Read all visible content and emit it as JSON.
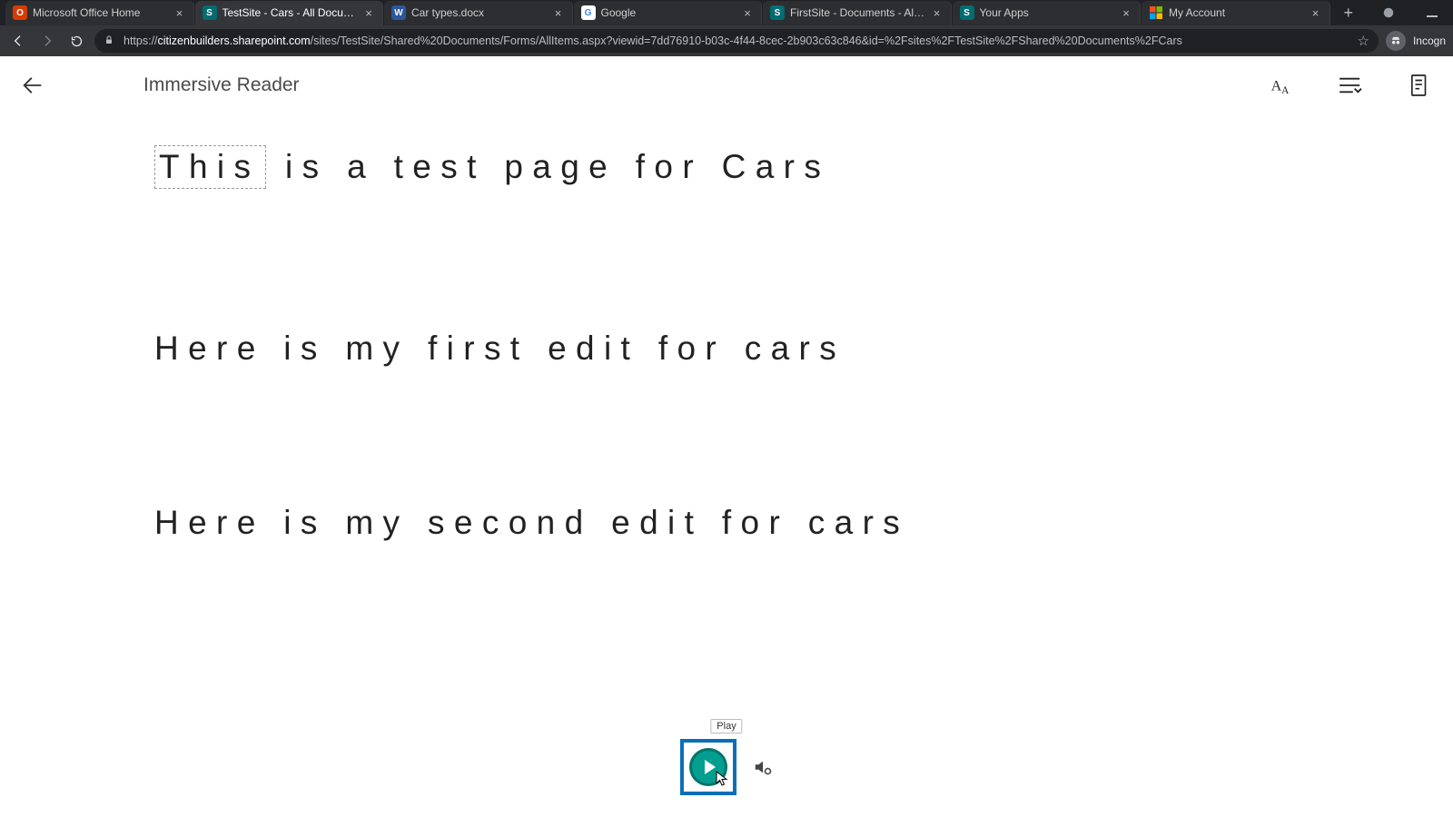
{
  "browser": {
    "tabs": [
      {
        "title": "Microsoft Office Home",
        "favicon_bg": "#d83b01",
        "favicon_fg": "#ffffff",
        "favicon_letter": "O",
        "name": "tab-office-home"
      },
      {
        "title": "TestSite - Cars - All Documents",
        "favicon_bg": "#036c70",
        "favicon_fg": "#ffffff",
        "favicon_letter": "S",
        "name": "tab-testsite-cars",
        "active": true
      },
      {
        "title": "Car types.docx",
        "favicon_bg": "#2b579a",
        "favicon_fg": "#ffffff",
        "favicon_letter": "W",
        "name": "tab-car-types"
      },
      {
        "title": "Google",
        "favicon_bg": "#ffffff",
        "favicon_fg": "#4285f4",
        "favicon_letter": "G",
        "name": "tab-google"
      },
      {
        "title": "FirstSite - Documents - All Docu…",
        "favicon_bg": "#036c70",
        "favicon_fg": "#ffffff",
        "favicon_letter": "S",
        "name": "tab-firstsite-docs"
      },
      {
        "title": "Your Apps",
        "favicon_bg": "#036c70",
        "favicon_fg": "#ffffff",
        "favicon_letter": "S",
        "name": "tab-your-apps"
      },
      {
        "title": "My Account",
        "favicon_bg": "#ffffff",
        "favicon_fg": "#000000",
        "favicon_letter": "",
        "ms_logo": true,
        "name": "tab-my-account"
      }
    ],
    "url_host": "citizenbuilders.sharepoint.com",
    "url_path": "/sites/TestSite/Shared%20Documents/Forms/AllItems.aspx?viewid=7dd76910-b03c-4f44-8cec-2b903c63c846&id=%2Fsites%2FTestSite%2FShared%20Documents%2FCars",
    "url_scheme": "https://",
    "incognito_label": "Incogn"
  },
  "reader": {
    "title": "Immersive Reader",
    "highlighted_word": "This",
    "para1_rest": " is a test page for Cars",
    "para2": "Here is my first edit for cars",
    "para3": "Here is my second edit for cars",
    "play_tooltip": "Play"
  },
  "icons": {
    "back": "back-arrow-icon",
    "text_prefs": "text-preferences-icon",
    "grammar": "grammar-options-icon",
    "reading_prefs": "reading-preferences-icon",
    "play": "play-icon",
    "voice_settings": "voice-settings-icon"
  }
}
